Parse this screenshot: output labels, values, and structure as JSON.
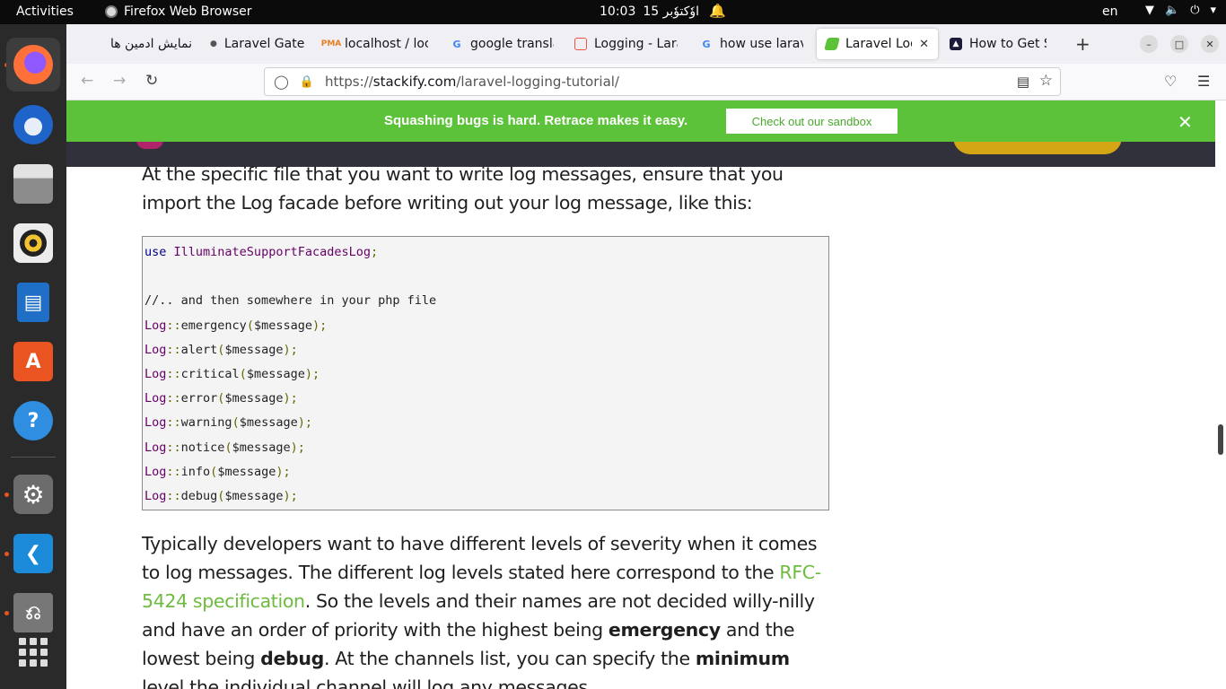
{
  "topbar": {
    "activities": "Activities",
    "app_name": "Firefox Web Browser",
    "time": "10:03",
    "date": "15 اوٗکتوٗبر",
    "language": "en"
  },
  "tabs": [
    {
      "label": "نمایش ادمین ها",
      "favicon": "none"
    },
    {
      "label": "Laravel Gates a",
      "favicon": "dot-icon"
    },
    {
      "label": "localhost / loca",
      "favicon": "phpmyadmin-icon"
    },
    {
      "label": "google transla",
      "favicon": "google-icon"
    },
    {
      "label": "Logging - Larav",
      "favicon": "laravel-icon"
    },
    {
      "label": "how use larave",
      "favicon": "google-icon"
    },
    {
      "label": "Laravel Logg",
      "favicon": "stackify-icon"
    },
    {
      "label": "How to Get Sta",
      "favicon": "site-icon"
    }
  ],
  "url": {
    "prefix": "https://",
    "domain": "stackify.com",
    "path": "/laravel-logging-tutorial/"
  },
  "banner": {
    "message": "Squashing bugs is hard. Retrace makes it easy.",
    "button": "Check out our sandbox"
  },
  "article": {
    "intro": "At the specific file that you want to write log messages, ensure that you import the Log facade before writing out your log message, like this:",
    "para_start": "Typically developers want to have different levels of severity when it comes to log messages. The different log levels stated here correspond to the ",
    "link": "RFC-5424 specification",
    "para_mid1": ". So the levels and their names are not decided willy-nilly and have an order of priority with the highest being ",
    "bold1": "emergency",
    "para_mid2": " and the lowest being ",
    "bold2": "debug",
    "para_mid3": ". At the channels list, you can specify the ",
    "bold3": "minimum",
    "para_end": " level the individual channel will log any messages."
  },
  "code": {
    "use_kw": "use",
    "use_ns": "IlluminateSupportFacadesLog",
    "comment": "//.. and then somewhere in your php file",
    "class": "Log",
    "separator": "::",
    "argument": "$message",
    "methods": [
      "emergency",
      "alert",
      "critical",
      "error",
      "warning",
      "notice",
      "info",
      "debug"
    ]
  }
}
